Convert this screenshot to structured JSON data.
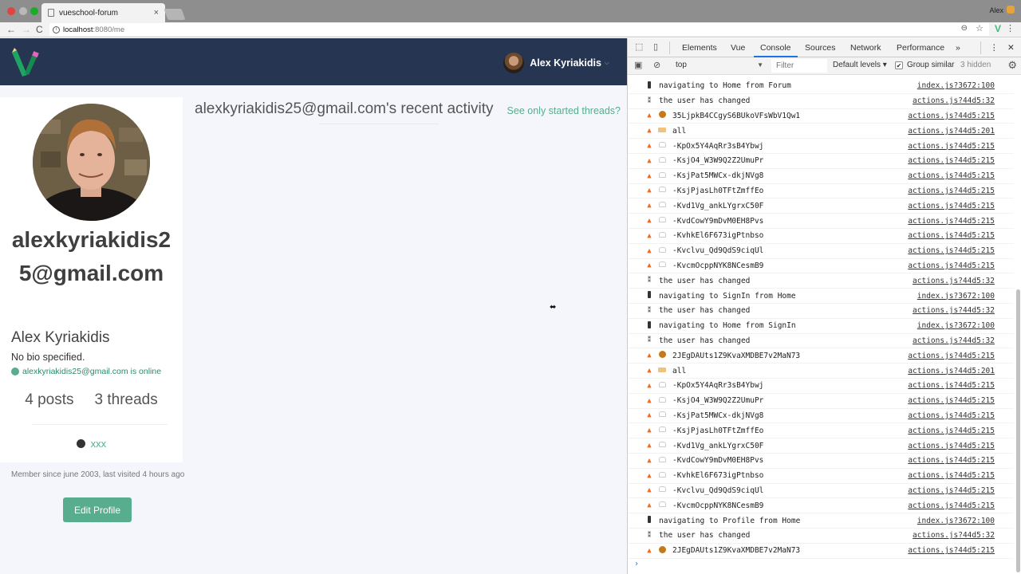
{
  "browser": {
    "tab_title": "vueschool-forum",
    "tab_close": "×",
    "profile_name": "Alex",
    "url_host": "localhost",
    "url_path": ":8080/me",
    "back": "←",
    "forward": "→",
    "reload": "C",
    "info": "i",
    "zoom_icon": "⊖",
    "star_icon": "☆",
    "extension_icon": "V",
    "menu_icon": "⋮"
  },
  "app": {
    "user_menu_name": "Alex Kyriakidis",
    "user_menu_caret": "⌵",
    "profile": {
      "username": "alexkyriakidis25@gmail.com",
      "full_name": "Alex Kyriakidis",
      "bio": "No bio specified.",
      "online_status": "alexkyriakidis25@gmail.com is online",
      "posts": "4 posts",
      "threads": "3 threads",
      "website": "xxx",
      "member_since": "Member since june 2003, last visited 4 hours ago",
      "edit_button": "Edit Profile"
    },
    "activity": {
      "heading": "alexkyriakidis25@gmail.com's recent activity",
      "toggle_link": "See only started threads?"
    },
    "cursor": "⬌",
    "colors": {
      "header_bg": "#253552",
      "accent": "#57ad8d"
    }
  },
  "devtools": {
    "tabs": [
      "Elements",
      "Vue",
      "Console",
      "Sources",
      "Network",
      "Performance"
    ],
    "active_tab": "Console",
    "more_tabs": "»",
    "menu_icon": "⋮",
    "close_icon": "✕",
    "context": "top",
    "context_arrow": "▼",
    "filter_placeholder": "Filter",
    "levels": "Default levels ▾",
    "group_similar_checked": "✔",
    "group_similar": "Group similar",
    "hidden_count": "3 hidden",
    "gear_icon": "⚙",
    "prompt": "›",
    "logs": [
      {
        "icon": "traffic",
        "sub": "",
        "text": "navigating to Home from Forum",
        "src": "index.js?3672:100"
      },
      {
        "icon": "feet",
        "sub": "",
        "text": "the user has changed",
        "src": "actions.js?44d5:32"
      },
      {
        "icon": "fire",
        "sub": "avatar",
        "text": "35LjpkB4CCgyS6BUkoVFsWbV1Qw1",
        "src": "actions.js?44d5:215"
      },
      {
        "icon": "fire",
        "sub": "tag",
        "text": "all",
        "src": "actions.js?44d5:201"
      },
      {
        "icon": "fire",
        "sub": "ghost",
        "text": "-KpOx5Y4AqRr3sB4Ybwj",
        "src": "actions.js?44d5:215"
      },
      {
        "icon": "fire",
        "sub": "ghost",
        "text": "-KsjO4_W3W9Q2Z2UmuPr",
        "src": "actions.js?44d5:215"
      },
      {
        "icon": "fire",
        "sub": "ghost",
        "text": "-KsjPat5MWCx-dkjNVg8",
        "src": "actions.js?44d5:215"
      },
      {
        "icon": "fire",
        "sub": "ghost",
        "text": "-KsjPjasLh0TFtZmffEo",
        "src": "actions.js?44d5:215"
      },
      {
        "icon": "fire",
        "sub": "ghost",
        "text": "-Kvd1Vg_ankLYgrxC50F",
        "src": "actions.js?44d5:215"
      },
      {
        "icon": "fire",
        "sub": "ghost",
        "text": "-KvdCowY9mDvM0EH8Pvs",
        "src": "actions.js?44d5:215"
      },
      {
        "icon": "fire",
        "sub": "ghost",
        "text": "-KvhkEl6F673igPtnbso",
        "src": "actions.js?44d5:215"
      },
      {
        "icon": "fire",
        "sub": "ghost",
        "text": "-Kvclvu_Qd9QdS9ciqUl",
        "src": "actions.js?44d5:215"
      },
      {
        "icon": "fire",
        "sub": "ghost",
        "text": "-KvcmOcppNYK8NCesmB9",
        "src": "actions.js?44d5:215"
      },
      {
        "icon": "feet",
        "sub": "",
        "text": "the user has changed",
        "src": "actions.js?44d5:32"
      },
      {
        "icon": "traffic",
        "sub": "",
        "text": "navigating to SignIn from Home",
        "src": "index.js?3672:100"
      },
      {
        "icon": "feet",
        "sub": "",
        "text": "the user has changed",
        "src": "actions.js?44d5:32"
      },
      {
        "icon": "traffic",
        "sub": "",
        "text": "navigating to Home from SignIn",
        "src": "index.js?3672:100"
      },
      {
        "icon": "feet",
        "sub": "",
        "text": "the user has changed",
        "src": "actions.js?44d5:32"
      },
      {
        "icon": "fire",
        "sub": "avatar",
        "text": "2JEgDAUts1Z9KvaXMDBE7v2MaN73",
        "src": "actions.js?44d5:215"
      },
      {
        "icon": "fire",
        "sub": "tag",
        "text": "all",
        "src": "actions.js?44d5:201"
      },
      {
        "icon": "fire",
        "sub": "ghost",
        "text": "-KpOx5Y4AqRr3sB4Ybwj",
        "src": "actions.js?44d5:215"
      },
      {
        "icon": "fire",
        "sub": "ghost",
        "text": "-KsjO4_W3W9Q2Z2UmuPr",
        "src": "actions.js?44d5:215"
      },
      {
        "icon": "fire",
        "sub": "ghost",
        "text": "-KsjPat5MWCx-dkjNVg8",
        "src": "actions.js?44d5:215"
      },
      {
        "icon": "fire",
        "sub": "ghost",
        "text": "-KsjPjasLh0TFtZmffEo",
        "src": "actions.js?44d5:215"
      },
      {
        "icon": "fire",
        "sub": "ghost",
        "text": "-Kvd1Vg_ankLYgrxC50F",
        "src": "actions.js?44d5:215"
      },
      {
        "icon": "fire",
        "sub": "ghost",
        "text": "-KvdCowY9mDvM0EH8Pvs",
        "src": "actions.js?44d5:215"
      },
      {
        "icon": "fire",
        "sub": "ghost",
        "text": "-KvhkEl6F673igPtnbso",
        "src": "actions.js?44d5:215"
      },
      {
        "icon": "fire",
        "sub": "ghost",
        "text": "-Kvclvu_Qd9QdS9ciqUl",
        "src": "actions.js?44d5:215"
      },
      {
        "icon": "fire",
        "sub": "ghost",
        "text": "-KvcmOcppNYK8NCesmB9",
        "src": "actions.js?44d5:215"
      },
      {
        "icon": "traffic",
        "sub": "",
        "text": "navigating to Profile from Home",
        "src": "index.js?3672:100"
      },
      {
        "icon": "feet",
        "sub": "",
        "text": "the user has changed",
        "src": "actions.js?44d5:32"
      },
      {
        "icon": "fire",
        "sub": "avatar",
        "text": "2JEgDAUts1Z9KvaXMDBE7v2MaN73",
        "src": "actions.js?44d5:215"
      }
    ]
  }
}
